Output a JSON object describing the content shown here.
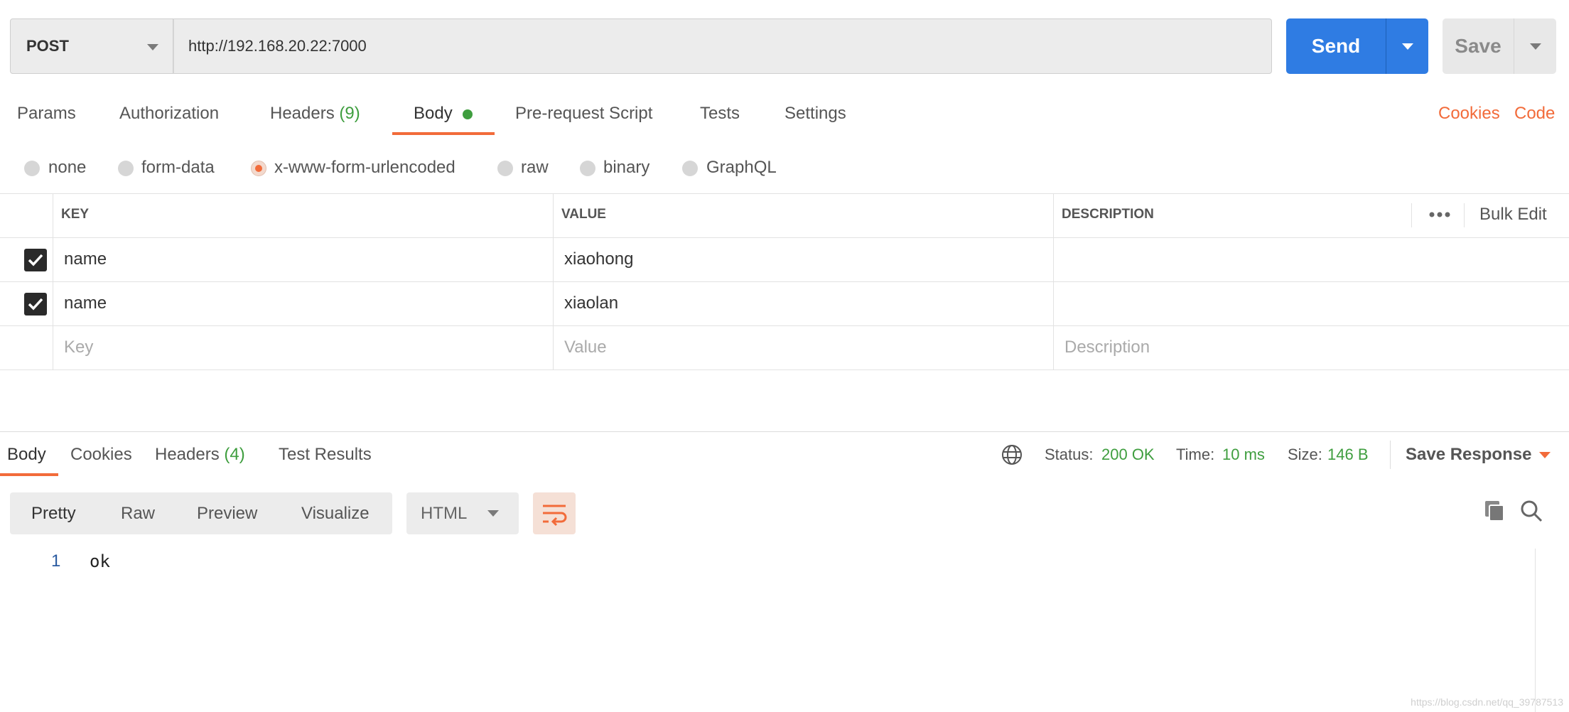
{
  "request": {
    "method": "POST",
    "url": "http://192.168.20.22:7000",
    "send_label": "Send",
    "save_label": "Save"
  },
  "request_tabs": [
    {
      "label": "Params"
    },
    {
      "label": "Authorization"
    },
    {
      "label": "Headers",
      "count": "(9)"
    },
    {
      "label": "Body",
      "active": true
    },
    {
      "label": "Pre-request Script"
    },
    {
      "label": "Tests"
    },
    {
      "label": "Settings"
    }
  ],
  "right_links": {
    "cookies": "Cookies",
    "code": "Code"
  },
  "body_types": [
    "none",
    "form-data",
    "x-www-form-urlencoded",
    "raw",
    "binary",
    "GraphQL"
  ],
  "body_type_selected": "x-www-form-urlencoded",
  "table": {
    "headers": {
      "key": "KEY",
      "value": "VALUE",
      "description": "DESCRIPTION"
    },
    "bulk_edit": "Bulk Edit",
    "rows": [
      {
        "checked": true,
        "key": "name",
        "value": "xiaohong",
        "description": ""
      },
      {
        "checked": true,
        "key": "name",
        "value": "xiaolan",
        "description": ""
      }
    ],
    "placeholders": {
      "key": "Key",
      "value": "Value",
      "description": "Description"
    }
  },
  "response": {
    "tabs": [
      {
        "label": "Body",
        "active": true
      },
      {
        "label": "Cookies"
      },
      {
        "label": "Headers",
        "count": "(4)"
      },
      {
        "label": "Test Results"
      }
    ],
    "status_label": "Status:",
    "status_value": "200 OK",
    "time_label": "Time:",
    "time_value": "10 ms",
    "size_label": "Size:",
    "size_value": "146 B",
    "save_response": "Save Response",
    "view_modes": [
      "Pretty",
      "Raw",
      "Preview",
      "Visualize"
    ],
    "format": "HTML",
    "lines": [
      {
        "num": "1",
        "text": "ok"
      }
    ]
  },
  "watermark": "https://blog.csdn.net/qq_39787513",
  "colors": {
    "accent": "#f26b3a",
    "send_blue": "#2f7ce3",
    "green": "#3f9e3f"
  }
}
